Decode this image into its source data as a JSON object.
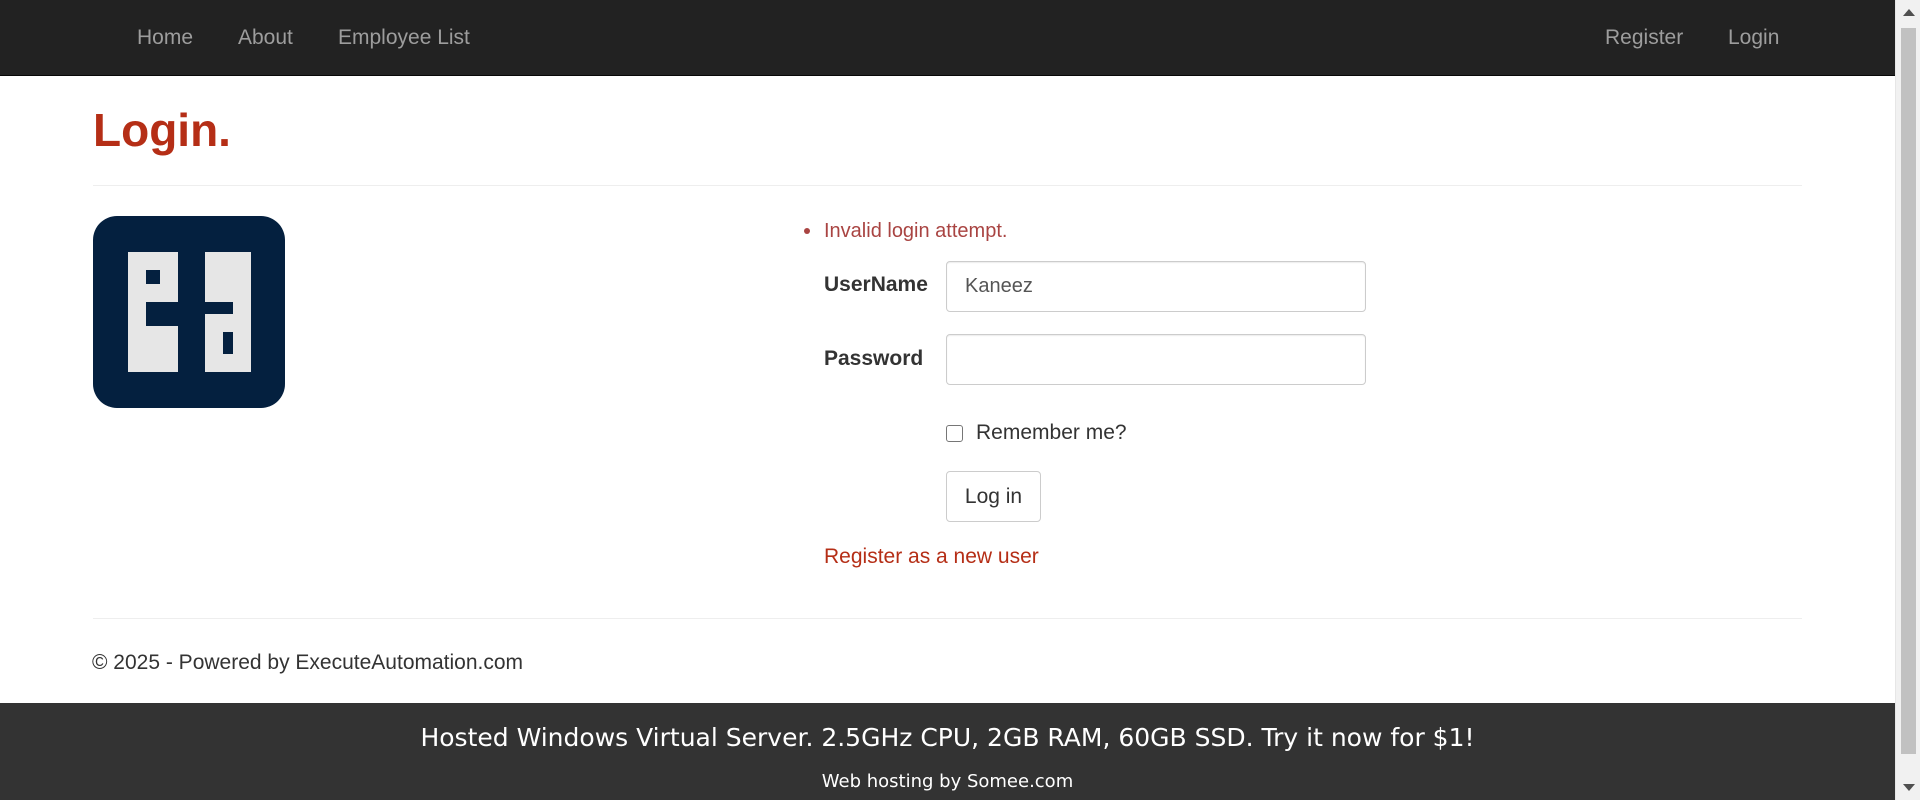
{
  "nav": {
    "home": "Home",
    "about": "About",
    "employee_list": "Employee List",
    "register": "Register",
    "login": "Login"
  },
  "page": {
    "title": "Login."
  },
  "logo": {
    "icon": "ea-logo-icon",
    "background_color": "#04203f",
    "glyph_color": "#e6e6e6"
  },
  "form": {
    "errors": [
      "Invalid login attempt."
    ],
    "username_label": "UserName",
    "username_value": "Kaneez",
    "password_label": "Password",
    "password_value": "",
    "remember_label": "Remember me?",
    "remember_checked": false,
    "submit_label": "Log in",
    "register_link": "Register as a new user"
  },
  "footer": {
    "copyright": "© 2025 - Powered by ExecuteAutomation.com"
  },
  "hosting": {
    "ad_text": "Hosted Windows Virtual Server. 2.5GHz CPU, 2GB RAM, 60GB SSD. Try it now for $1!",
    "credit_text": "Web hosting by Somee.com"
  },
  "colors": {
    "navbar": "#222222",
    "accent": "#b52e16",
    "error": "#a94442",
    "hosting_bar": "#333333"
  }
}
